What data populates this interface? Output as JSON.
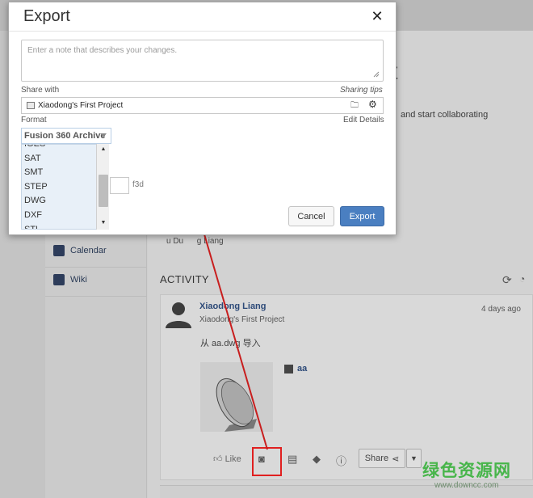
{
  "background": {
    "sidebar": {
      "items": [
        {
          "label": "Calendar",
          "icon": "calendar-icon"
        },
        {
          "label": "Wiki",
          "icon": "book-icon"
        }
      ]
    },
    "main": {
      "title_fragment": "t",
      "collab_text": "and start collaborating",
      "members_fragment": "u Du      g Liang",
      "activity_heading": "ACTIVITY",
      "activity_item": {
        "author": "Xiaodong Liang",
        "project": "Xiaodong's First Project",
        "time": "4 days ago",
        "message": "从 aa.dwg 导入",
        "file_name": "aa",
        "like_label": "Like",
        "share_label": "Share"
      }
    },
    "highlight_color": "#e02020"
  },
  "watermark": {
    "main": "绿色资源网",
    "sub": "www.downcc.com"
  },
  "modal": {
    "title": "Export",
    "close_symbol": "✕",
    "note_placeholder": "Enter a note that describes your changes.",
    "share_with_label": "Share with",
    "sharing_tips_label": "Sharing tips",
    "share_project": "Xiaodong's First Project",
    "format_label": "Format",
    "edit_details_label": "Edit Details",
    "format_selected": "Fusion 360 Archive",
    "format_options": [
      "IGES",
      "SAT",
      "SMT",
      "STEP",
      "DWG",
      "DXF",
      "STL"
    ],
    "file_extension": "f3d",
    "cancel_label": "Cancel",
    "export_label": "Export",
    "export_button_color": "#4a7fc1"
  }
}
